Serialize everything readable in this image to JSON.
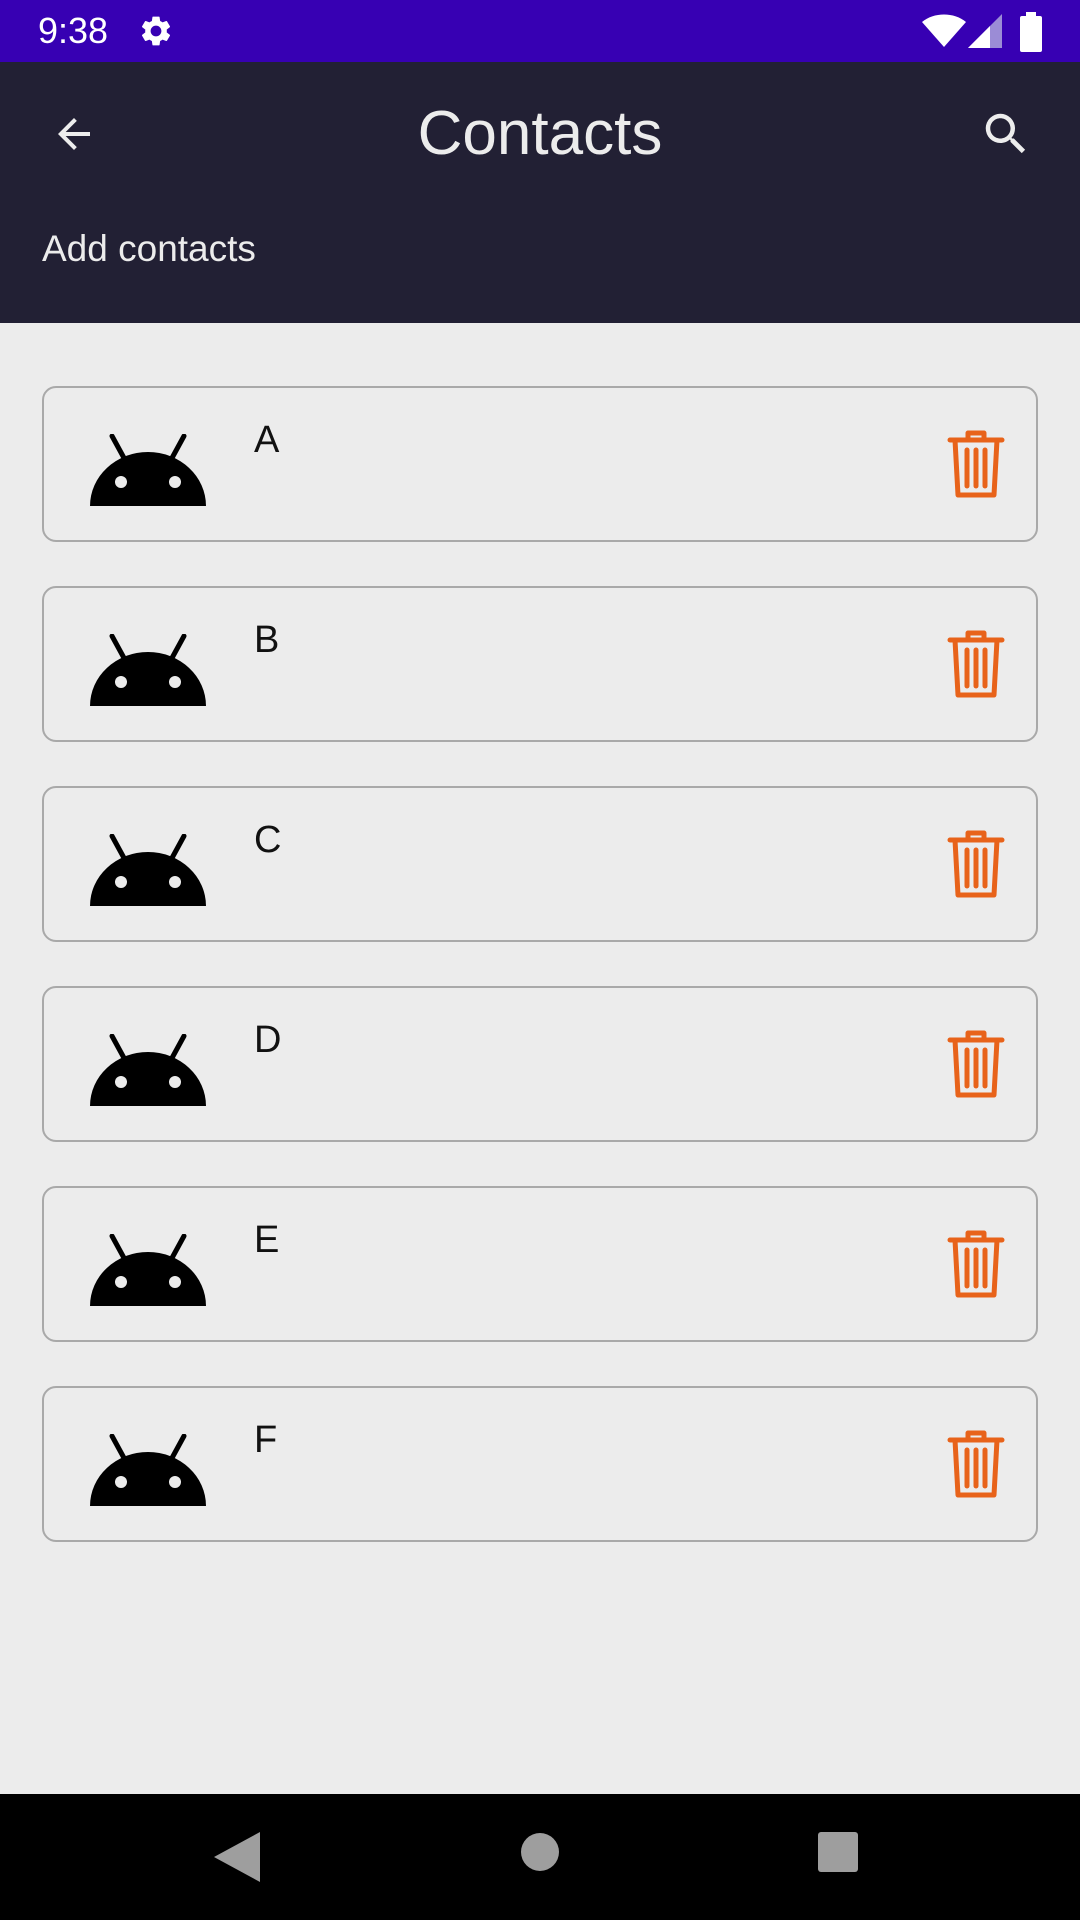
{
  "status_bar": {
    "time": "9:38",
    "icons": [
      "gear-icon",
      "wifi-icon",
      "cell-signal-icon",
      "battery-icon"
    ],
    "background": "#3700b3"
  },
  "app_bar": {
    "title": "Contacts",
    "subtitle": "Add contacts",
    "back_icon": "arrow-left-icon",
    "search_icon": "search-icon",
    "background": "#222034"
  },
  "contacts": [
    {
      "name": "A"
    },
    {
      "name": "B"
    },
    {
      "name": "C"
    },
    {
      "name": "D"
    },
    {
      "name": "E"
    },
    {
      "name": "F"
    }
  ],
  "colors": {
    "delete_icon": "#e8631a",
    "avatar_icon": "#000000",
    "card_border": "#a9a9a9",
    "page_background": "#ececec"
  },
  "nav_bar": {
    "icons": [
      "nav-back-icon",
      "nav-home-icon",
      "nav-recents-icon"
    ]
  }
}
